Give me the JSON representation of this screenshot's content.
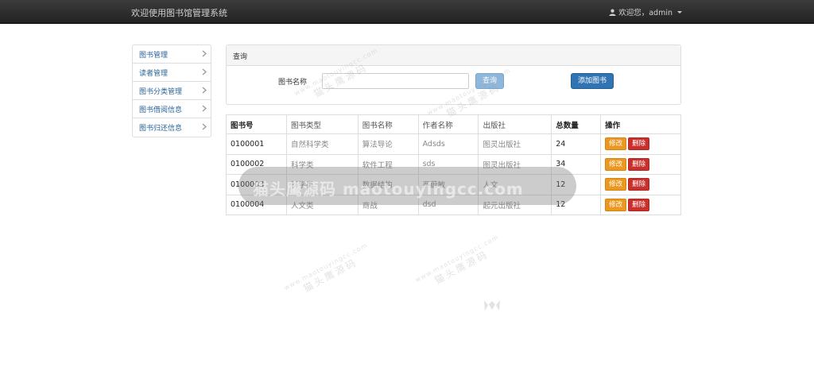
{
  "navbar": {
    "title": "欢迎使用图书馆管理系统",
    "user_label": "欢迎您，admin",
    "user_icon": "user-icon",
    "dropdown_icon": "caret-down-icon"
  },
  "sidebar": {
    "items": [
      {
        "label": "图书管理"
      },
      {
        "label": "读者管理"
      },
      {
        "label": "图书分类管理"
      },
      {
        "label": "图书借阅信息"
      },
      {
        "label": "图书归还信息"
      }
    ],
    "chevron_icon": "chevron-right-icon"
  },
  "query": {
    "heading": "查询",
    "field_label": "图书名称",
    "input_value": "",
    "search_label": "查询",
    "add_label": "添加图书"
  },
  "table": {
    "headers": [
      "图书号",
      "图书类型",
      "图书名称",
      "作者名称",
      "出版社",
      "总数量",
      "操作"
    ],
    "rows": [
      {
        "id": "0100001",
        "type": "自然科学类",
        "name": "算法导论",
        "author": "Adsds",
        "publisher": "图灵出版社",
        "count": "24"
      },
      {
        "id": "0100002",
        "type": "科学类",
        "name": "软件工程",
        "author": "sds",
        "publisher": "图灵出版社",
        "count": "34"
      },
      {
        "id": "0100003",
        "type": "科学类",
        "name": "数据结构",
        "author": "严蔚敏",
        "publisher": "人文",
        "count": "12"
      },
      {
        "id": "0100004",
        "type": "人文类",
        "name": "商战",
        "author": "dsd",
        "publisher": "起元出版社",
        "count": "12"
      }
    ],
    "edit_label": "修改",
    "delete_label": "删除"
  },
  "watermark": {
    "pill_text": "猫头鹰源码 maotouyingcc.com",
    "url": "www.maotouyingcc.com",
    "name": "猫头鹰源码"
  },
  "colors": {
    "navbar": "#222222",
    "link": "#2a6496",
    "primary": "#3174b3",
    "warning": "#ec971f",
    "danger": "#c9302c"
  }
}
